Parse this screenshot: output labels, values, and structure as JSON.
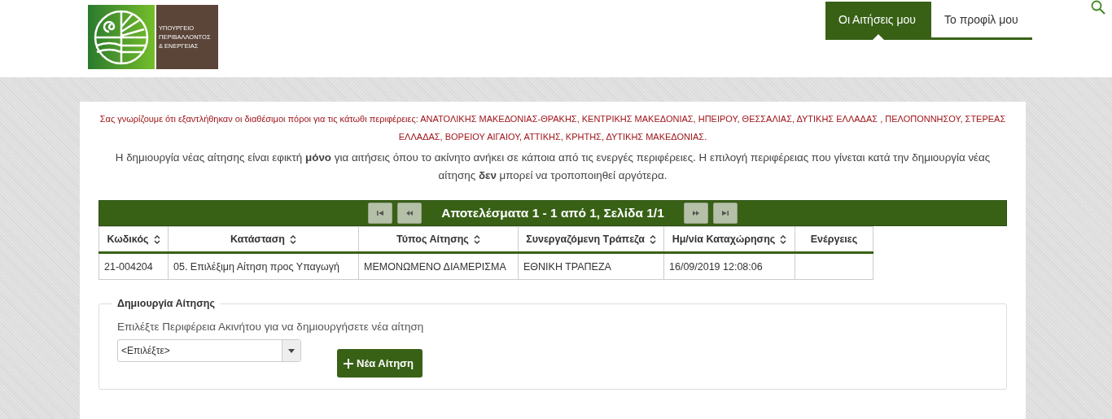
{
  "logo": {
    "lines": [
      "ΥΠΟΥΡΓΕΙΟ",
      "ΠΕΡΙΒΑΛΛΟΝΤΟΣ",
      "& ΕΝΕΡΓΕΙΑΣ"
    ]
  },
  "nav": [
    {
      "label": "Οι Αιτήσεις μου",
      "selected": true
    },
    {
      "label": "Το προφίλ μου",
      "selected": false
    }
  ],
  "notice": "Σας γνωρίζουμε ότι εξαντλήθηκαν οι διαθέσιμοι πόροι για τις κάτωθι περιφέρειες: ΑΝΑΤΟΛΙΚΗΣ ΜΑΚΕΔΟΝΙΑΣ-ΘΡΑΚΗΣ, ΚΕΝΤΡΙΚΗΣ ΜΑΚΕΔΟΝΙΑΣ, ΗΠΕΙΡΟΥ, ΘΕΣΣΑΛΙΑΣ, ΔΥΤΙΚΗΣ ΕΛΛΑΔΑΣ , ΠΕΛΟΠΟΝΝΗΣΟΥ, ΣΤΕΡΕΑΣ ΕΛΛΑΔΑΣ, ΒΟΡΕΙΟΥ ΑΙΓΑΙΟΥ, ΑΤΤΙΚΗΣ, ΚΡΗΤΗΣ, ΔΥΤΙΚΗΣ ΜΑΚΕΔΟΝΙΑΣ.",
  "info": "Η δημιουργία νέας αίτησης είναι εφικτή **μόνο** για αιτήσεις όπου το ακίνητο ανήκει σε κάποια από τις ενεργές περιφέρειες. Η επιλογή περιφέρειας που γίνεται κατά την δημιουργία νέας αίτησης **δεν** μπορεί να τροποποιηθεί αργότερα.",
  "pager": {
    "summary": "Αποτελέσματα 1 - 1 από 1, Σελίδα 1/1"
  },
  "table": {
    "columns": [
      {
        "label": "Κωδικός",
        "sortable": true
      },
      {
        "label": "Κατάσταση",
        "sortable": true
      },
      {
        "label": "Τύπος Αίτησης",
        "sortable": true
      },
      {
        "label": "Συνεργαζόμενη Τράπεζα",
        "sortable": true
      },
      {
        "label": "Ημ/νία Καταχώρησης",
        "sortable": true
      },
      {
        "label": "Ενέργειες",
        "sortable": false
      }
    ],
    "rows": [
      [
        "21-004204",
        "05. Επιλέξιμη Αίτηση προς Υπαγωγή",
        "ΜΕΜΟΝΩΜΕΝΟ ΔΙΑΜΕΡΙΣΜΑ",
        "ΕΘΝΙΚΗ ΤΡΑΠΕΖΑ",
        "16/09/2019 12:08:06",
        ""
      ]
    ]
  },
  "create": {
    "legend": "Δημιουργία Αίτησης",
    "label": "Επιλέξτε Περιφέρεια Ακινήτου για να δημιουργήσετε νέα αίτηση",
    "select_value": "<Επιλέξτε>",
    "button": "Νέα Αίτηση"
  }
}
